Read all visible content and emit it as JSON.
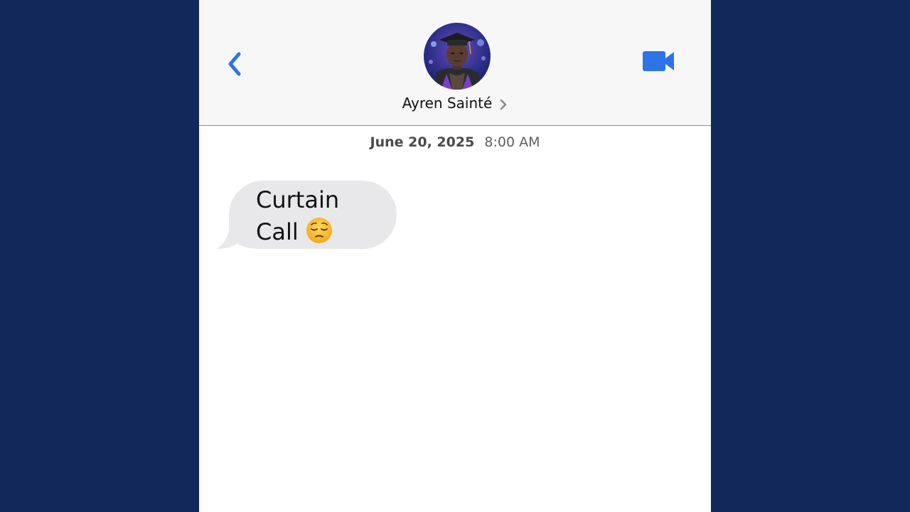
{
  "colors": {
    "background": "#12275a",
    "accent": "#2d74e8",
    "incoming_bubble": "#e8e8ea",
    "header_bg": "#f7f7f7"
  },
  "header": {
    "back_icon": "chevron-left-icon",
    "video_icon": "video-camera-icon",
    "contact_name": "Ayren Sainté",
    "contact_chevron_icon": "chevron-right-icon",
    "avatar": "graduation-photo"
  },
  "conversation": {
    "date": "June 20, 2025",
    "time": "8:00 AM",
    "messages": [
      {
        "direction": "incoming",
        "text": "Curtain Call",
        "emoji": "pensive-face-emoji"
      }
    ]
  }
}
